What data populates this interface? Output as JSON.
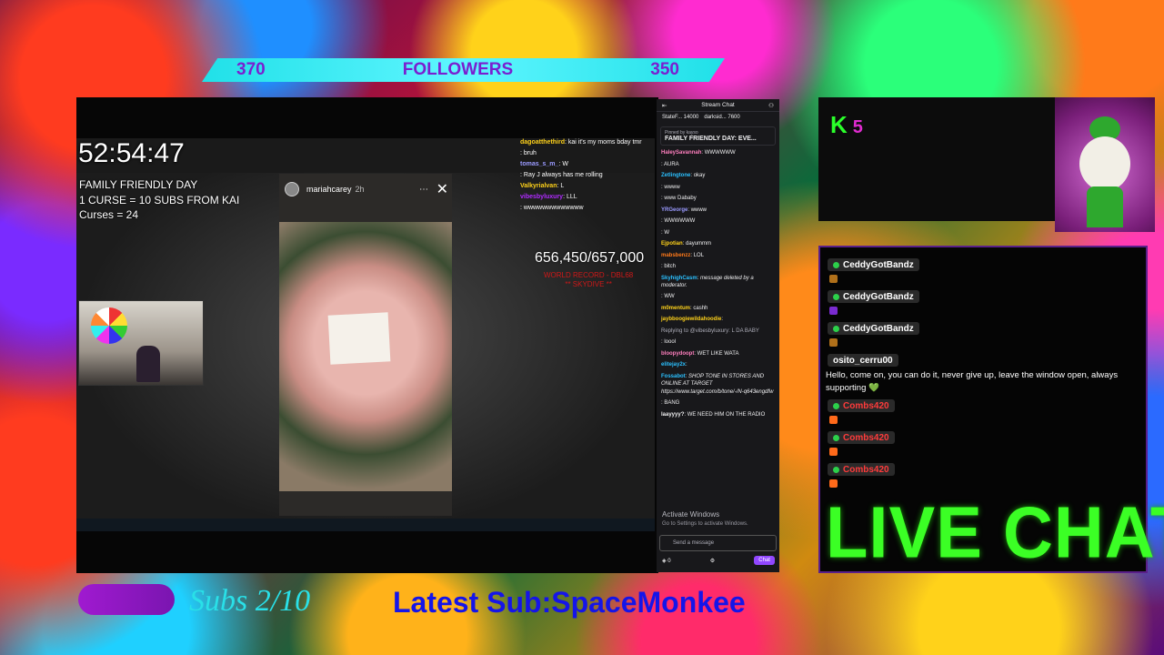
{
  "followers_bar": {
    "left_count": "370",
    "label": "FOLLOWERS",
    "right_count": "350"
  },
  "stream": {
    "timer": "52:54:47",
    "overlay_lines": [
      "FAMILY FRIENDLY DAY",
      "1 CURSE = 10 SUBS FROM KAI",
      "Curses = 24"
    ],
    "goal_count": "656,450/657,000",
    "goal_label_line1": "WORLD RECORD - DBL68",
    "goal_label_line2": "** SKYDIVE **"
  },
  "story": {
    "username": "mariahcarey",
    "time": "2h",
    "more_icon": "⋯",
    "close_icon": "✕"
  },
  "inner_chat": [
    {
      "user": "dagoatthethird",
      "text": "kai it's my moms bday tmr"
    },
    {
      "user": "",
      "text": "bruh"
    },
    {
      "user": "tomas_s_m_",
      "text": "W"
    },
    {
      "user": "",
      "text": "Ray J always has me rolling"
    },
    {
      "user": "Valkyrialvan",
      "text": "L"
    },
    {
      "user": "vibesbyluxury",
      "text": "LLL"
    },
    {
      "user": "",
      "text": "wwwwwwwwwwwww"
    }
  ],
  "twitch_chat": {
    "title": "Stream Chat",
    "top_chatters": [
      "StateF... 14000",
      "darksid... 7600"
    ],
    "pinned_label": "Pinned by kayso",
    "pinned_message": "FAMILY FRIENDLY DAY: EVE...",
    "messages": [
      {
        "user": "HaleySavannah",
        "text": "WWWWWW",
        "color": "#ff7fbf"
      },
      {
        "user": "",
        "text": "AURA",
        "color": "#ff3b3b"
      },
      {
        "user": "Zetlingtone",
        "text": "okay",
        "color": "#2bc0ff"
      },
      {
        "user": "",
        "text": "wwww",
        "color": "#b02bff"
      },
      {
        "user": "",
        "text": "www Dababy",
        "color": "#1f8fff"
      },
      {
        "user": "YRGeorge",
        "text": "wwww",
        "color": "#9a9aff"
      },
      {
        "user": "",
        "text": "WWWWWW",
        "color": "#ff3b3b"
      },
      {
        "user": "",
        "text": "W",
        "color": "#2b2bff"
      },
      {
        "user": "Ejpotian",
        "text": "dayummm",
        "color": "#ffd21a"
      },
      {
        "user": "mabsbenzz",
        "text": "LOL",
        "color": "#ff7a1a"
      },
      {
        "user": "",
        "text": "bitch",
        "color": "#2b2bff"
      },
      {
        "user": "SkyhighCasm",
        "text": "message deleted by a moderator.",
        "color": "#2bc0ff"
      },
      {
        "user": "",
        "text": "WW",
        "color": "#ff7fbf"
      },
      {
        "user": "m0mentum",
        "text": "cashh",
        "color": "#ffd21a"
      },
      {
        "user": "jaybboogiewildahoodie",
        "text": "",
        "color": "#ffd21a"
      },
      {
        "user": "",
        "text": "Replying to @vibesbyluxury: L DA BABY",
        "color": "#adadb8"
      },
      {
        "user": "",
        "text": "loool",
        "color": "#2b2bff"
      },
      {
        "user": "bloopydoopt",
        "text": "WET LIKE WATA",
        "color": "#ff7fbf"
      },
      {
        "user": "elitejay2x",
        "text": "",
        "color": "#2bc0ff"
      },
      {
        "user": "Fossabot",
        "text": "SHOP TONE IN STORES AND ONLINE AT TARGET https://www.target.com/b/tone/-/N-q643engdfw",
        "color": "#2bc0ff"
      },
      {
        "user": "",
        "text": "BANG",
        "color": "#2b2bff"
      },
      {
        "user": "laayyyy?",
        "text": "WE NEED HIM ON THE RADIO",
        "color": "#efeff1"
      }
    ],
    "activate_line1": "Activate Windows",
    "activate_line2": "Go to Settings to activate Windows.",
    "input_placeholder": "Send a message",
    "points": "0",
    "chat_button": "Chat"
  },
  "k5_panel": {
    "letter": "K",
    "number": "5"
  },
  "right_chat": {
    "names": [
      "CeddyGotBandz",
      "CeddyGotBandz",
      "CeddyGotBandz",
      "osito_cerru00",
      "Combs420",
      "Combs420",
      "Combs420"
    ],
    "message": "Hello, come on, you can do it, never give up, leave the window open, always supporting 💚",
    "live_chat": "LIVE CHAT"
  },
  "bottom_bar": {
    "subs": "Subs 2/10",
    "latest_sub": "Latest Sub:SpaceMonkee"
  },
  "colors": {
    "followers_bg": "#5ff6ff",
    "followers_text": "#7a1fd0",
    "live_chat": "#3bff25",
    "latest_sub": "#1515e8",
    "subs": "#29e0e8",
    "twitch_accent": "#9147ff"
  }
}
